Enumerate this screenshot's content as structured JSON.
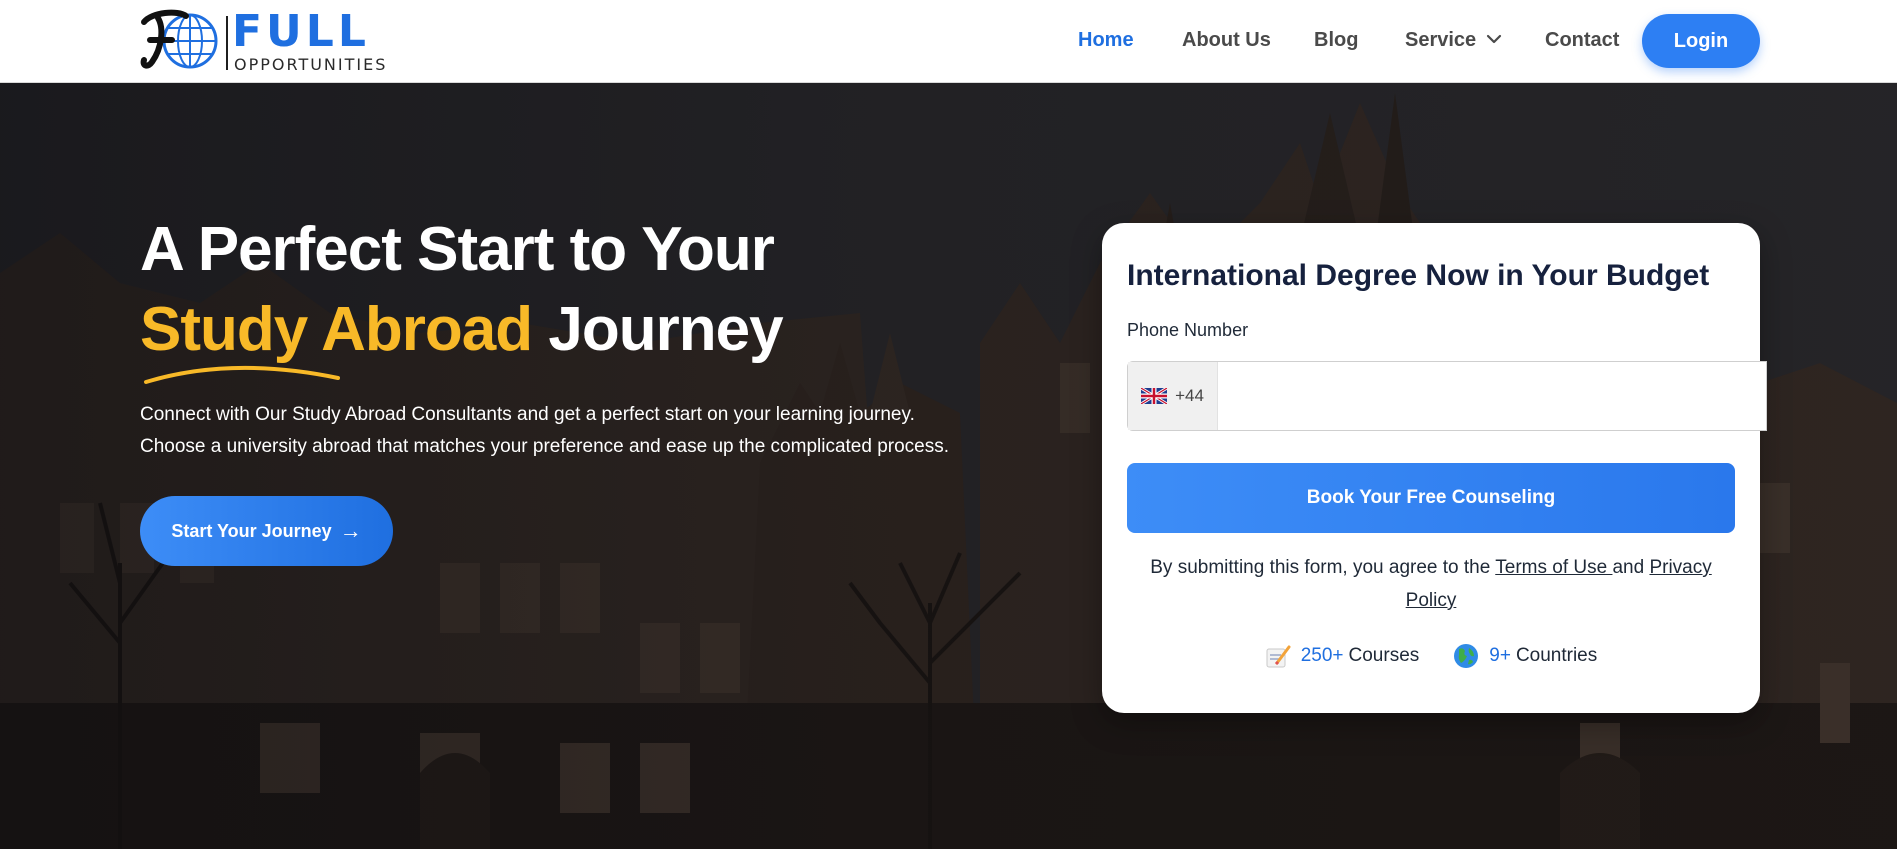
{
  "brand": {
    "primary": "FULL",
    "secondary": "OPPORTUNITIES",
    "accent_color": "#1f6fe0"
  },
  "nav": {
    "items": [
      {
        "label": "Home",
        "active": true
      },
      {
        "label": "About Us",
        "active": false
      },
      {
        "label": "Blog",
        "active": false
      },
      {
        "label": "Service",
        "active": false,
        "icon": "chevron-down-icon"
      },
      {
        "label": "Contact",
        "active": false
      }
    ],
    "login_label": "Login"
  },
  "hero": {
    "headline_line1": "A Perfect Start to Your",
    "headline_accent": "Study Abroad",
    "headline_rest": " Journey",
    "subtitle_line1": "Connect with Our Study Abroad Consultants and get a perfect start on your learning journey.",
    "subtitle_line2": "Choose a university abroad that matches your preference and ease up the complicated process.",
    "cta_label": "Start Your Journey",
    "cta_icon": "arrow-right-icon",
    "accent_color": "#f8b928"
  },
  "form": {
    "title": "International Degree Now in Your Budget",
    "phone_label": "Phone Number",
    "country_code": "+44",
    "country_flag": "uk-flag-icon",
    "phone_value": "",
    "submit_label": "Book Your Free Counseling",
    "terms_prefix": "By submitting this form, you agree to the ",
    "terms_link": "Terms of Use ",
    "terms_and": "and ",
    "privacy_link": "Privacy Policy",
    "stats": [
      {
        "icon": "writing-icon",
        "number": "250+",
        "label": "Courses"
      },
      {
        "icon": "globe-icon",
        "number": "9+",
        "label": "Countries"
      }
    ]
  }
}
